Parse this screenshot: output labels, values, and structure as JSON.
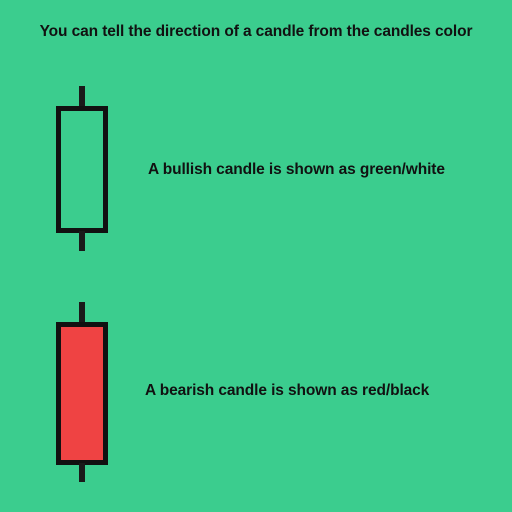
{
  "colors": {
    "background": "#3bcd8e",
    "bullish_body": "#3bcd8e",
    "bearish_body": "#ef4343",
    "outline": "#111111"
  },
  "title": "You can tell the direction of a candle from the candles color",
  "candles": [
    {
      "type": "bullish",
      "label": "A bullish candle is shown as green/white"
    },
    {
      "type": "bearish",
      "label": "A bearish candle is shown as red/black"
    }
  ]
}
